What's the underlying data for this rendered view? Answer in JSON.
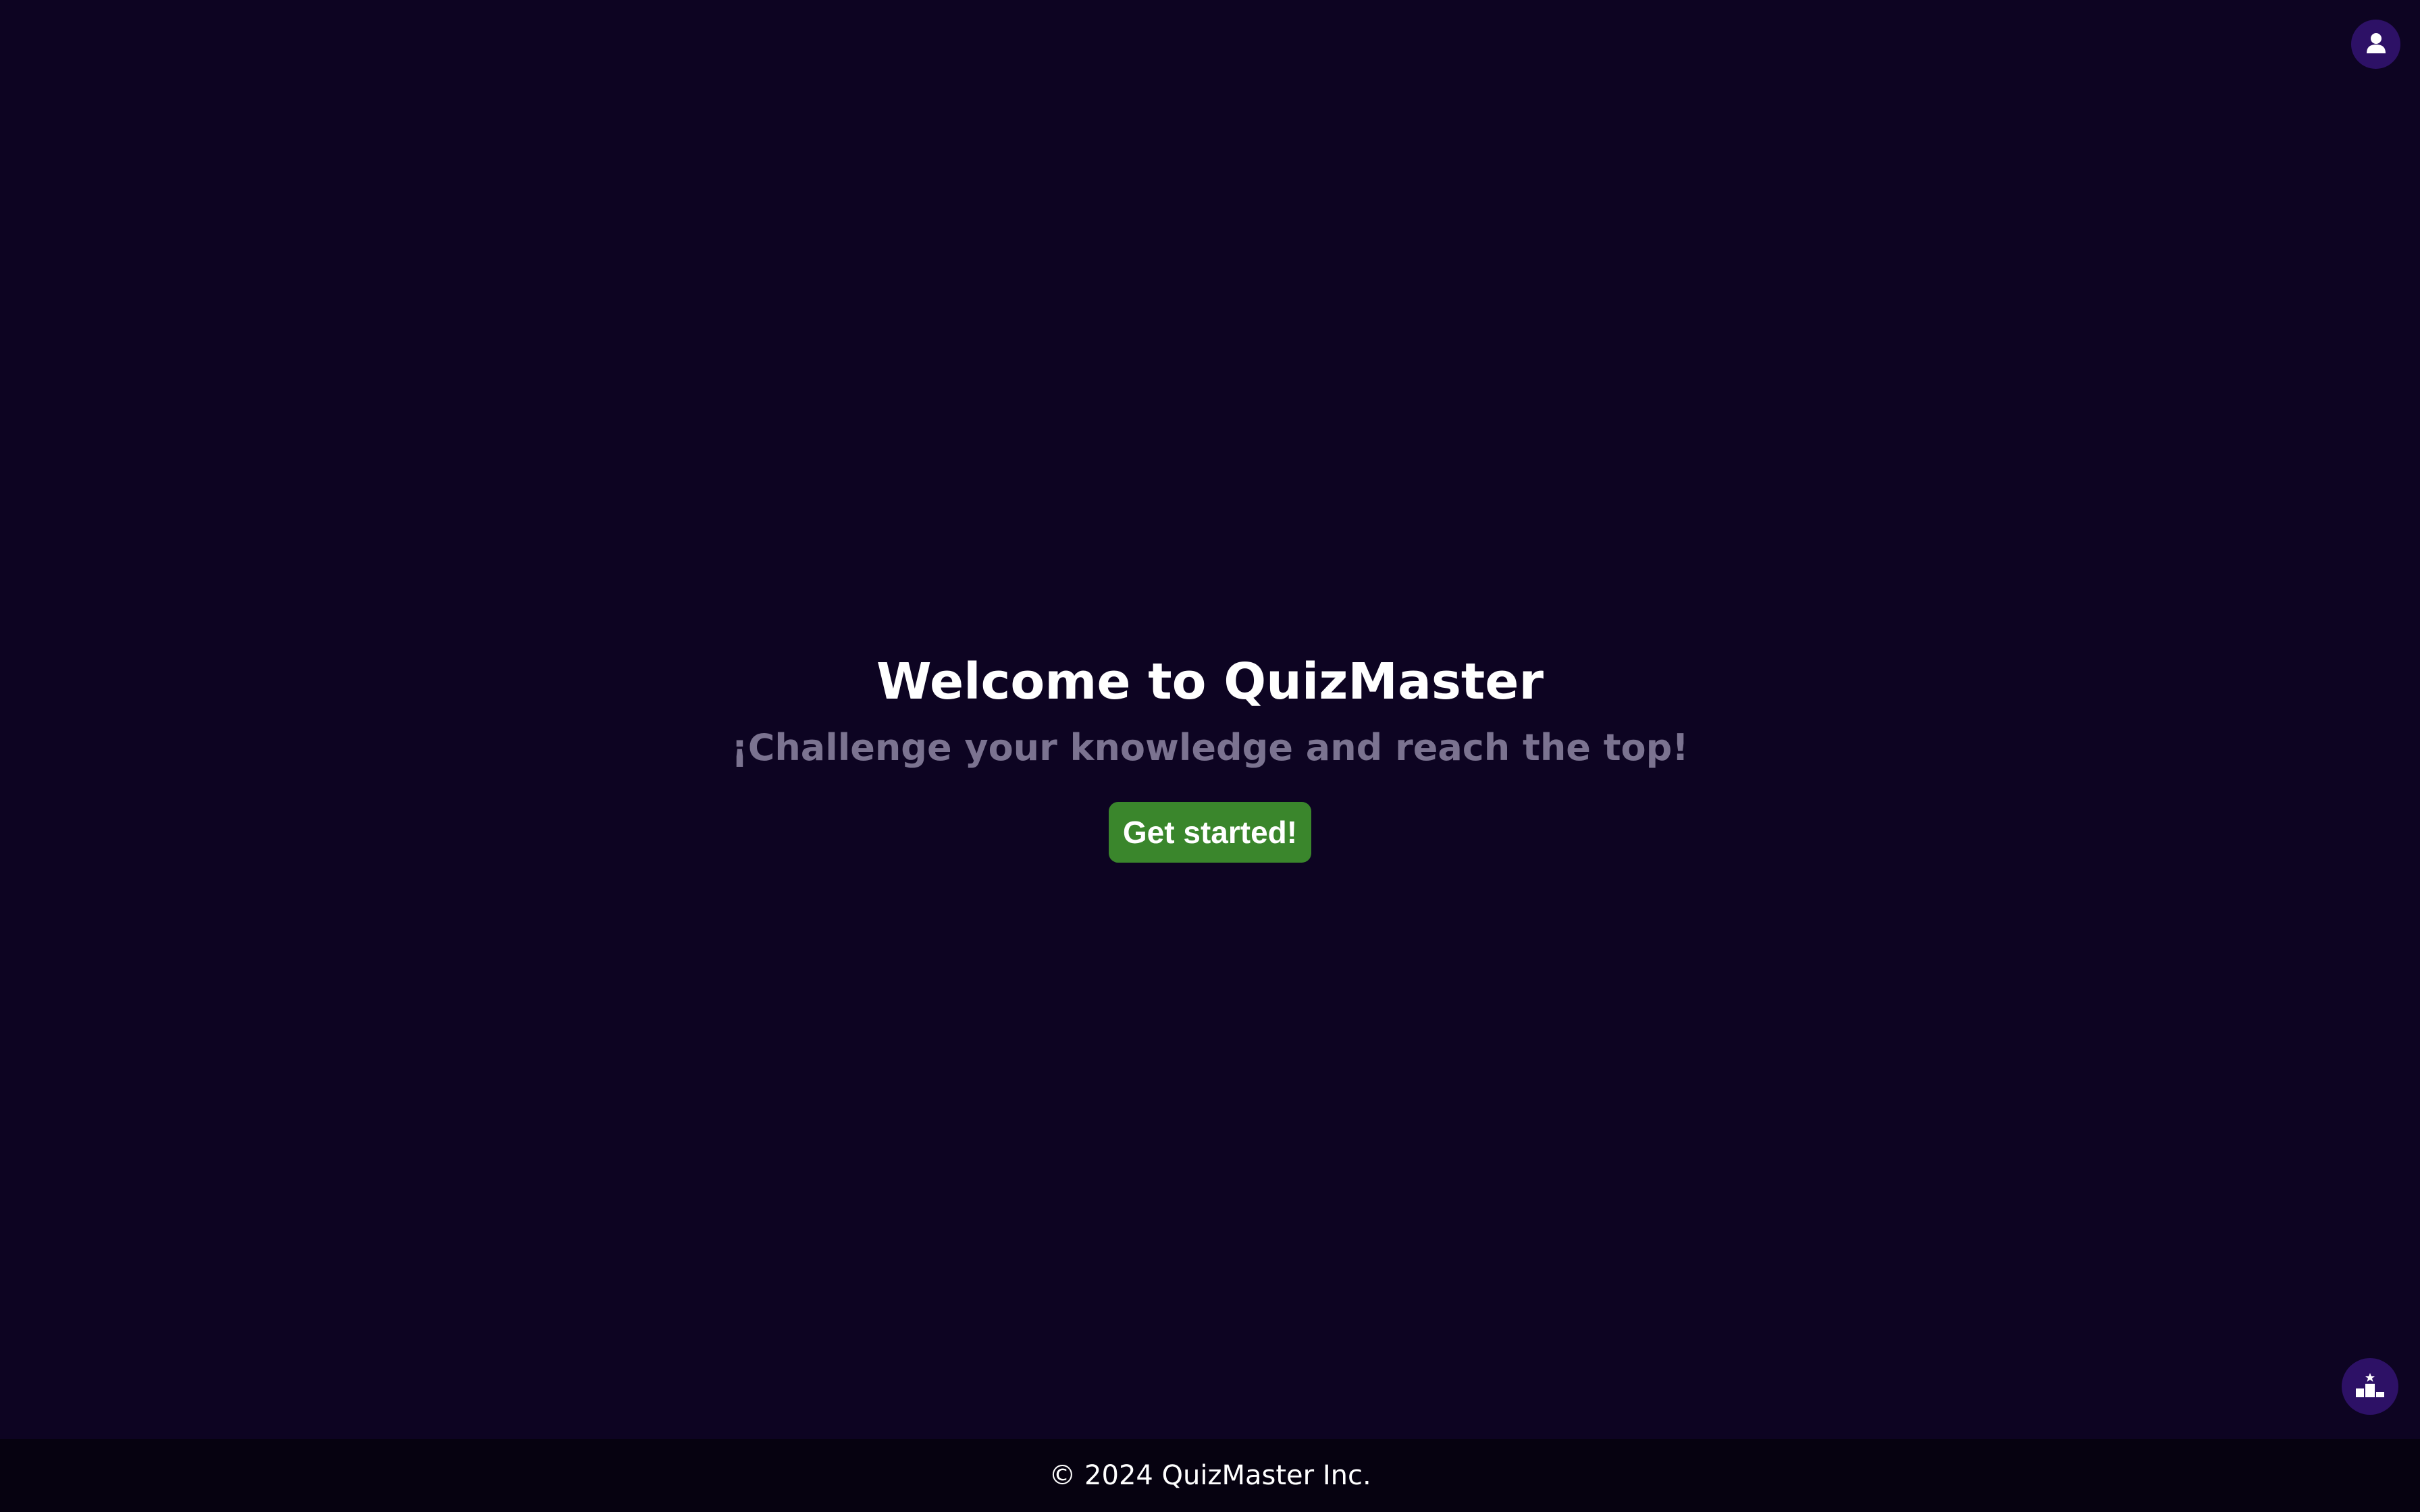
{
  "header": {
    "profile_icon": "user-icon"
  },
  "hero": {
    "title": "Welcome to QuizMaster",
    "subtitle": "¡Challenge your knowledge and reach the top!",
    "cta_label": "Get started!"
  },
  "floating": {
    "leaderboard_icon": "podium-icon"
  },
  "footer": {
    "copyright": "© 2024 QuizMaster Inc."
  },
  "colors": {
    "background": "#0d0422",
    "footer_background": "#060210",
    "accent_circle": "#2d1166",
    "cta_green": "#3a862c",
    "subtitle_gray": "#7b7390",
    "text_white": "#ffffff"
  }
}
